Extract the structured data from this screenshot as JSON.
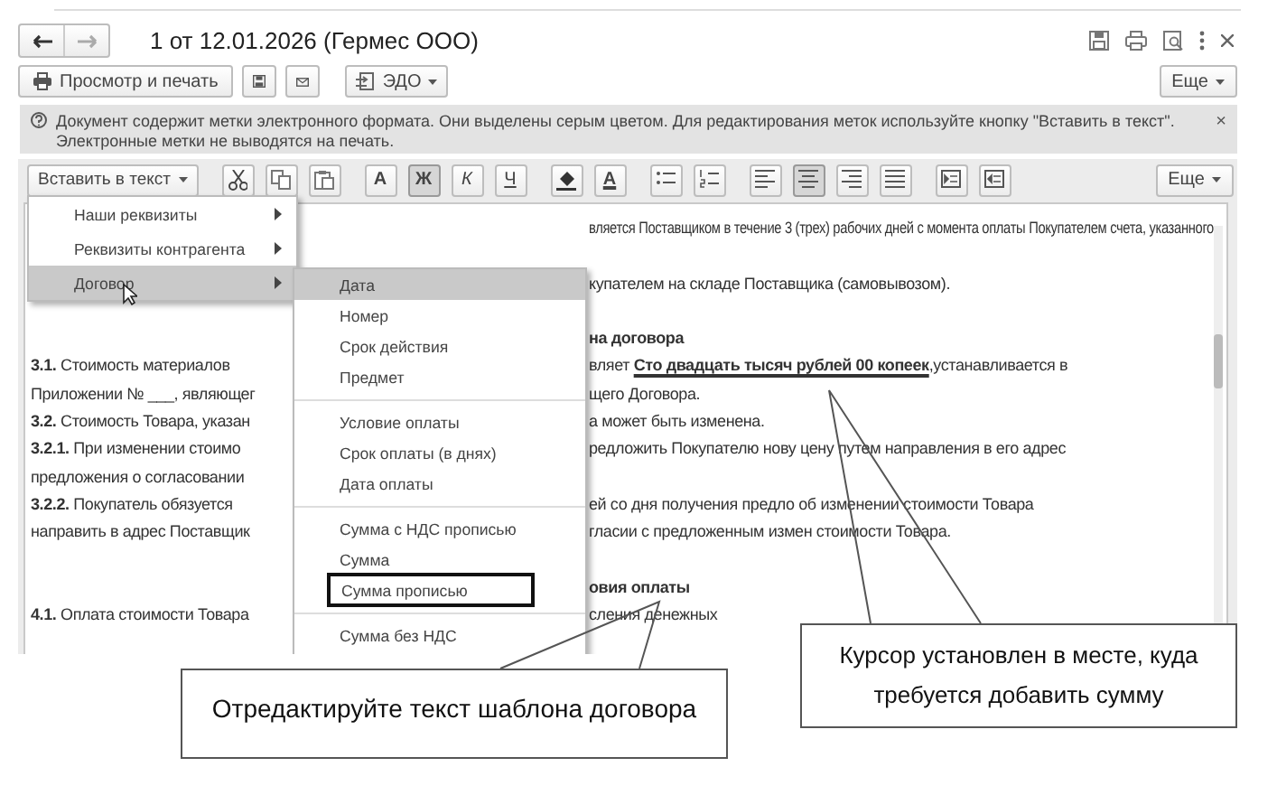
{
  "window": {
    "title": "1 от 12.01.2026 (Гермес ООО)"
  },
  "command_bar": {
    "print_button": "Просмотр и печать",
    "edo_button": "ЭДО",
    "more_button": "Еще"
  },
  "info_bar": {
    "text": "Документ содержит метки электронного формата. Они выделены серым цветом. Для редактирования меток используйте кнопку \"Вставить в текст\". Электронные метки не выводятся на печать.",
    "close": "×"
  },
  "editor_toolbar": {
    "insert_button": "Вставить в текст",
    "more_button": "Еще",
    "tool_groups": [
      [
        {
          "kind": "cut",
          "pressed": false
        },
        {
          "kind": "copy",
          "pressed": false
        },
        {
          "kind": "paste",
          "pressed": false
        }
      ],
      [
        {
          "kind": "font",
          "label": "A",
          "pressed": false
        },
        {
          "kind": "bold",
          "label": "Ж",
          "pressed": true
        },
        {
          "kind": "italic",
          "label": "К",
          "pressed": false
        },
        {
          "kind": "underline",
          "label": "Ч",
          "pressed": false
        }
      ],
      [
        {
          "kind": "fill",
          "pressed": false
        },
        {
          "kind": "font-color",
          "label": "A",
          "pressed": false
        }
      ],
      [
        {
          "kind": "bullets",
          "pressed": false
        },
        {
          "kind": "numbering",
          "pressed": false
        }
      ],
      [
        {
          "kind": "align-left",
          "pressed": false
        },
        {
          "kind": "align-center",
          "pressed": true
        },
        {
          "kind": "align-right",
          "pressed": false
        },
        {
          "kind": "justify",
          "pressed": false
        }
      ],
      [
        {
          "kind": "indent",
          "pressed": false
        },
        {
          "kind": "outdent",
          "pressed": false
        }
      ]
    ]
  },
  "document": {
    "lines": [
      {
        "kind": "text",
        "right": "вляется Поставщиком в течение 3 (трех) рабочих дней с момента оплаты Покупателем счета, указанного"
      },
      {
        "kind": "blank"
      },
      {
        "kind": "text",
        "right": "купателем на складе Поставщика (самовывозом)."
      },
      {
        "kind": "blank"
      },
      {
        "kind": "heading",
        "right": "на договора"
      },
      {
        "kind": "text",
        "left": "**3.1.** Стоимость материалов",
        "right": "вляет **Сто двадцать тысяч рублей 00 копеек**,устанавливается в",
        "underlined": true
      },
      {
        "kind": "text",
        "left": "Приложении № ___, являющег",
        "right": "щего Договора."
      },
      {
        "kind": "text",
        "left": "**3.2.** Стоимость Товара, указан",
        "right": "а может быть изменена."
      },
      {
        "kind": "text",
        "left": "**3.2.1.** При изменении стоимо",
        "right": "редложить Покупателю нову цену путем направления в его адрес"
      },
      {
        "kind": "text",
        "left": "предложения о согласовании"
      },
      {
        "kind": "text",
        "left": "**3.2.2.** Покупатель обязуется",
        "right": "ей со дня получения предло об изменении стоимости Товара"
      },
      {
        "kind": "text",
        "left": "направить в адрес Поставщик",
        "right": "гласии с предложенным измен стоимости Товара."
      },
      {
        "kind": "blank"
      },
      {
        "kind": "heading",
        "right": "овия оплаты"
      },
      {
        "kind": "text",
        "left": "**4.1.** Оплата стоимости Товара",
        "right": "сления денежных"
      }
    ]
  },
  "insert_menu": {
    "items": [
      {
        "label": "Наши реквизиты",
        "selected": false,
        "has_submenu": true
      },
      {
        "label": "Реквизиты контрагента",
        "selected": false,
        "has_submenu": true
      },
      {
        "label": "Договор",
        "selected": true,
        "has_submenu": true
      }
    ]
  },
  "submenu": {
    "groups": [
      [
        {
          "label": "Дата",
          "selected": true,
          "outlined": false
        },
        {
          "label": "Номер",
          "selected": false,
          "outlined": false
        },
        {
          "label": "Срок действия",
          "selected": false,
          "outlined": false
        },
        {
          "label": "Предмет",
          "selected": false,
          "outlined": false
        }
      ],
      [
        {
          "label": "Условие оплаты",
          "selected": false,
          "outlined": false
        },
        {
          "label": "Срок оплаты (в днях)",
          "selected": false,
          "outlined": false
        },
        {
          "label": "Дата оплаты",
          "selected": false,
          "outlined": false
        }
      ],
      [
        {
          "label": "Сумма с НДС прописью",
          "selected": false,
          "outlined": false
        },
        {
          "label": "Сумма",
          "selected": false,
          "outlined": false
        },
        {
          "label": "Сумма прописью",
          "selected": false,
          "outlined": true
        }
      ],
      [
        {
          "label": "Сумма без НДС",
          "selected": false,
          "outlined": false
        }
      ]
    ]
  },
  "callouts": [
    {
      "text": "Отредактируйте текст шаблона договора"
    },
    {
      "text": "Курсор установлен в месте, куда требуется добавить сумму"
    }
  ]
}
